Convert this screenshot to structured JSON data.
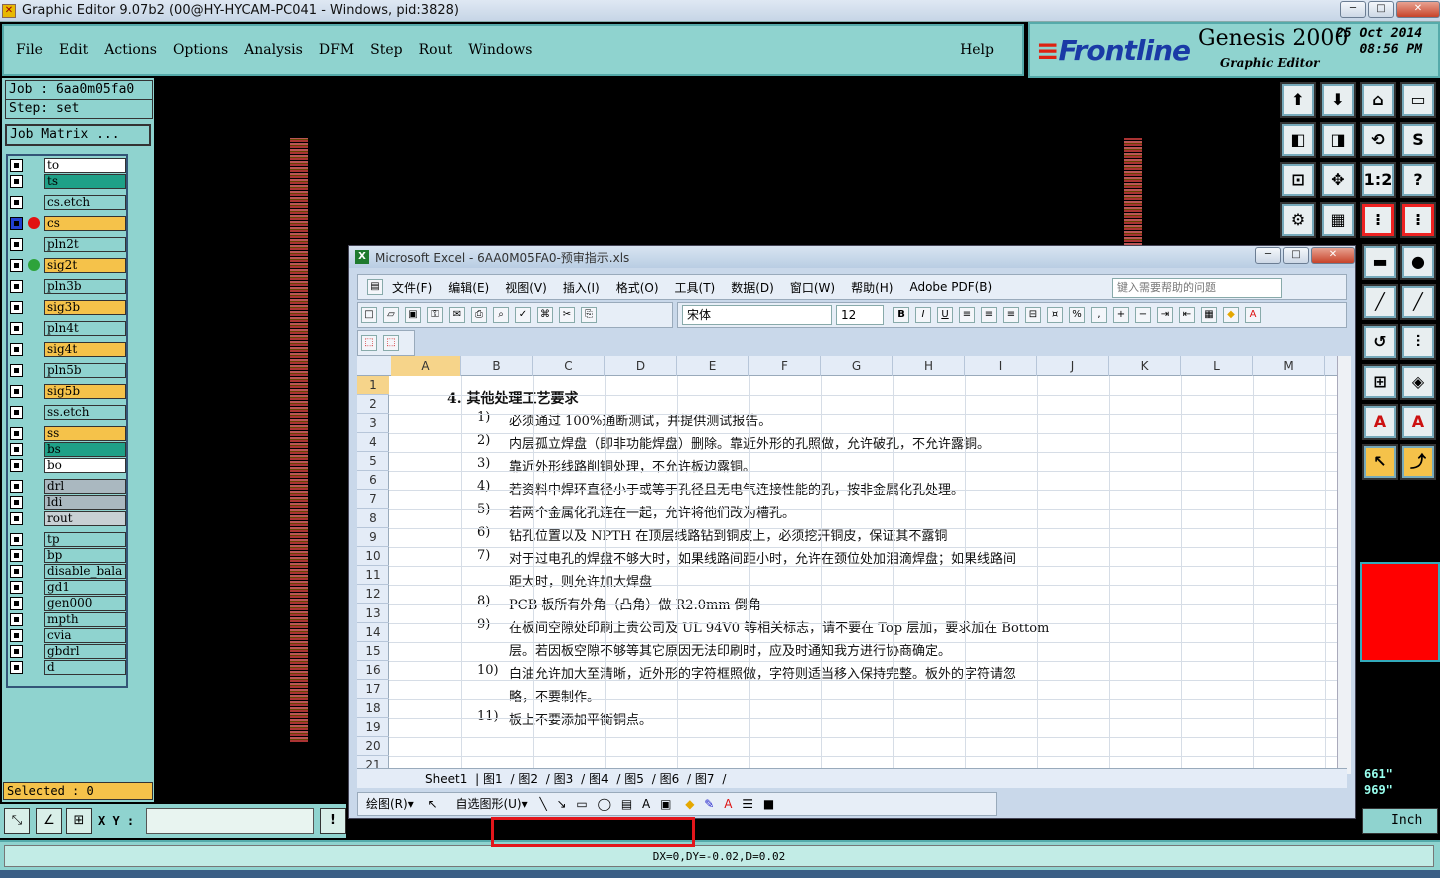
{
  "app": {
    "title": "Graphic Editor 9.07b2 (00@HY-HYCAM-PC041 - Windows, pid:3828)"
  },
  "menu": [
    "File",
    "Edit",
    "Actions",
    "Options",
    "Analysis",
    "DFM",
    "Step",
    "Rout",
    "Windows"
  ],
  "help": "Help",
  "logo": {
    "brand": "Frontline",
    "product": "Genesis 2000",
    "subtitle": "Graphic Editor",
    "date": "25 Oct 2014",
    "time": "08:56 PM"
  },
  "job": {
    "job": "Job : 6aa0m05fa0",
    "step": "Step: set",
    "matrix": "Job Matrix ..."
  },
  "layers": [
    {
      "name": "to",
      "bg": "#ffffff",
      "dot": ""
    },
    {
      "name": "ts",
      "bg": "#1fa087",
      "dot": ""
    },
    {
      "name": "cs.etch",
      "bg": "#8fd3cf",
      "dot": ""
    },
    {
      "name": "cs",
      "bg": "#f5c24a",
      "dot": "#e21212",
      "sel": true
    },
    {
      "name": "pln2t",
      "bg": "#8fd3cf",
      "dot": ""
    },
    {
      "name": "sig2t",
      "bg": "#f5c24a",
      "dot": "#2ea33a"
    },
    {
      "name": "pln3b",
      "bg": "#8fd3cf",
      "dot": ""
    },
    {
      "name": "sig3b",
      "bg": "#f5c24a",
      "dot": ""
    },
    {
      "name": "pln4t",
      "bg": "#8fd3cf",
      "dot": ""
    },
    {
      "name": "sig4t",
      "bg": "#f5c24a",
      "dot": ""
    },
    {
      "name": "pln5b",
      "bg": "#8fd3cf",
      "dot": ""
    },
    {
      "name": "sig5b",
      "bg": "#f5c24a",
      "dot": ""
    },
    {
      "name": "ss.etch",
      "bg": "#8fd3cf",
      "dot": ""
    },
    {
      "name": "ss",
      "bg": "#f5c24a",
      "dot": ""
    },
    {
      "name": "bs",
      "bg": "#1fa087",
      "dot": ""
    },
    {
      "name": "bo",
      "bg": "#ffffff",
      "dot": ""
    },
    {
      "name": "drl",
      "bg": "#aab8c0",
      "dot": ""
    },
    {
      "name": "ldi",
      "bg": "#aab8c0",
      "dot": ""
    },
    {
      "name": "rout",
      "bg": "#c8d0d4",
      "dot": ""
    },
    {
      "name": "tp",
      "bg": "#8fd3cf",
      "dot": ""
    },
    {
      "name": "bp",
      "bg": "#8fd3cf",
      "dot": ""
    },
    {
      "name": "disable_bala",
      "bg": "#8fd3cf",
      "dot": ""
    },
    {
      "name": "gd1",
      "bg": "#8fd3cf",
      "dot": ""
    },
    {
      "name": "gen000",
      "bg": "#8fd3cf",
      "dot": ""
    },
    {
      "name": "mpth",
      "bg": "#8fd3cf",
      "dot": ""
    },
    {
      "name": "cvia",
      "bg": "#8fd3cf",
      "dot": ""
    },
    {
      "name": "gbdrl",
      "bg": "#8fd3cf",
      "dot": ""
    },
    {
      "name": "d",
      "bg": "#8fd3cf",
      "dot": ""
    }
  ],
  "selected": "Selected : 0",
  "xy_label": "X Y :",
  "status": "DX=0,DY=-0.02,D=0.02",
  "coords": [
    "661\"",
    "969\""
  ],
  "unit": "Inch",
  "excel": {
    "title": "Microsoft Excel - 6AA0M05FA0-预审指示.xls",
    "menu": [
      "文件(F)",
      "编辑(E)",
      "视图(V)",
      "插入(I)",
      "格式(O)",
      "工具(T)",
      "数据(D)",
      "窗口(W)",
      "帮助(H)",
      "Adobe PDF(B)"
    ],
    "help_placeholder": "键入需要帮助的问题",
    "font": "宋体",
    "size": "12",
    "columns": [
      "A",
      "B",
      "C",
      "D",
      "E",
      "F",
      "G",
      "H",
      "I",
      "J",
      "K",
      "L",
      "M"
    ],
    "rows": [
      "1",
      "2",
      "3",
      "4",
      "5",
      "6",
      "7",
      "8",
      "9",
      "10",
      "11",
      "12",
      "13",
      "14",
      "15",
      "16",
      "17",
      "18",
      "19",
      "20",
      "21"
    ],
    "heading": "4.   其他处理工艺要求",
    "lines": [
      {
        "n": "1)",
        "t": "必须通过 100%通断测试，并提供测试报告。"
      },
      {
        "n": "2)",
        "t": "内层孤立焊盘（即非功能焊盘）删除。靠近外形的孔照做，允许破孔，不允许露铜。"
      },
      {
        "n": "3)",
        "t": "靠近外形线路削铜处理，不允许板边露铜。"
      },
      {
        "n": "4)",
        "t": "若资料中焊环直径小于或等于孔径且无电气连接性能的孔，按非金属化孔处理。"
      },
      {
        "n": "5)",
        "t": "若两个金属化孔连在一起，允许将他们改为槽孔。"
      },
      {
        "n": "6)",
        "t": "钻孔位置以及 NPTH 在顶层线路钻到铜皮上，必须挖开铜皮，保证其不露铜"
      },
      {
        "n": "7)",
        "t": "对于过电孔的焊盘不够大时，如果线路间距小时，允许在颈位处加泪滴焊盘；如果线路间"
      },
      {
        "n": "",
        "t": "距大时，则允许加大焊盘"
      },
      {
        "n": "8)",
        "t": "PCB 板所有外角（凸角）做 R2.0mm 倒角"
      },
      {
        "n": "9)",
        "t": "在板间空隙处印刷上贵公司及 UL 94V0 等相关标志，请不要在 Top 层加，要求加在 Bottom"
      },
      {
        "n": "",
        "t": "层。若因板空隙不够等其它原因无法印刷时，应及时通知我方进行协商确定。"
      },
      {
        "n": "10)",
        "t": "白油允许加大至清晰，近外形的字符框照做，字符则适当移入保持完整。板外的字符请忽"
      },
      {
        "n": "",
        "t": "略，不要制作。"
      },
      {
        "n": "11)",
        "t": "板上不要添加平衡铜点。"
      }
    ],
    "tabs": [
      "Sheet1",
      "图1",
      "图2",
      "图3",
      "图4",
      "图5",
      "图6",
      "图7"
    ],
    "draw_label": "绘图(R)▾",
    "autoshape_label": "自选图形(U)▾"
  }
}
